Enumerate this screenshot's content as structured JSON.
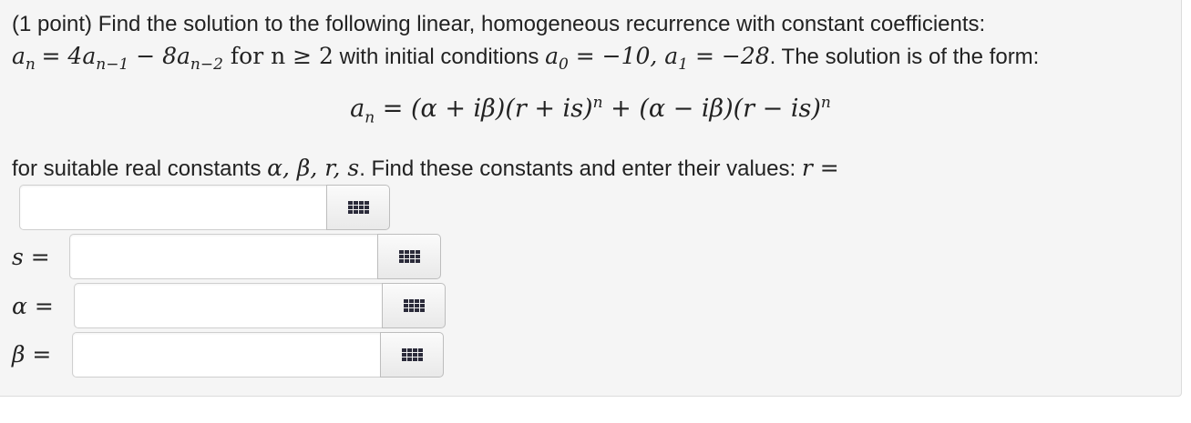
{
  "problem": {
    "prefix": "(1 point) Find the solution to the following linear, homogeneous recurrence with constant coefficients:",
    "recurrence_lhs": "a",
    "recurrence_lhs_sub": "n",
    "recurrence_rhs_part1": "= 4a",
    "recurrence_rhs_sub1": "n−1",
    "recurrence_rhs_part2": " − 8a",
    "recurrence_rhs_sub2": "n−2",
    "condition_text": " for n ≥ 2",
    "initial_intro": "with initial conditions",
    "init_a0": "a",
    "init_a0_sub": "0",
    "init_a0_val": " = −10, ",
    "init_a1": "a",
    "init_a1_sub": "1",
    "init_a1_val": " = −28",
    "form_text": ". The solution is of the form:",
    "display_lhs": "a",
    "display_lhs_sub": "n",
    "display_rhs_a": " = (α + iβ)(r + is)",
    "display_sup1": "n",
    "display_rhs_b": " + (α − iβ)(r − is)",
    "display_sup2": "n",
    "constants_text": "for suitable real constants",
    "constants_symbols": "α, β, r, s",
    "constants_tail": ". Find these constants and enter their values:",
    "r_label": "r ="
  },
  "answers": {
    "r": {
      "label": "r =",
      "value": ""
    },
    "s": {
      "label": "s =",
      "value": ""
    },
    "alpha": {
      "label": "α =",
      "value": ""
    },
    "beta": {
      "label": "β =",
      "value": ""
    }
  },
  "icons": {
    "keypad": "keypad-grid-icon"
  }
}
